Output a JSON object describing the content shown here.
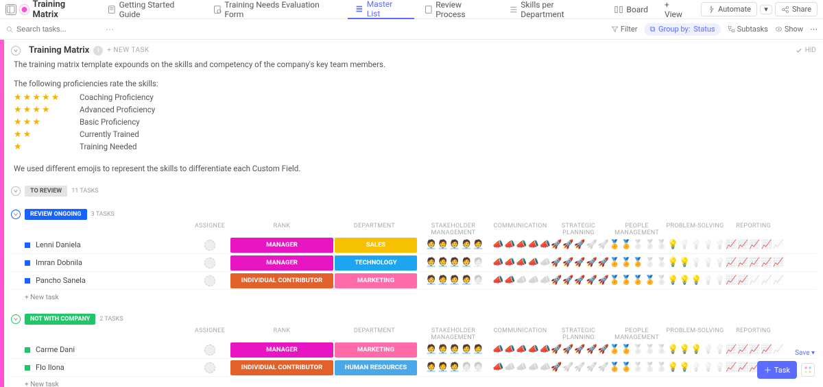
{
  "header": {
    "title": "Training Matrix",
    "tabs": [
      {
        "label": "Getting Started Guide"
      },
      {
        "label": "Training Needs Evaluation Form"
      },
      {
        "label": "Master List"
      },
      {
        "label": "Review Process"
      },
      {
        "label": "Skills per Department"
      },
      {
        "label": "Board"
      },
      {
        "label": "+ View"
      }
    ],
    "active_tab_index": 2,
    "automate": "Automate",
    "share": "Share"
  },
  "toolbar": {
    "search_placeholder": "Search tasks...",
    "filter": "Filter",
    "groupby_prefix": "Group by:",
    "groupby_value": "Status",
    "subtasks": "Subtasks",
    "show": "Show"
  },
  "section": {
    "title": "Training Matrix",
    "new_task": "+ NEW TASK",
    "hide": "HID",
    "description": "The training matrix template expounds on the skills and competency of the company's key team members.",
    "prof_heading": "The following proficiencies rate the skills:",
    "proficiencies": [
      {
        "stars": 5,
        "label": "Coaching Proficiency"
      },
      {
        "stars": 4,
        "label": "Advanced Proficiency"
      },
      {
        "stars": 3,
        "label": "Basic Proficiency"
      },
      {
        "stars": 2,
        "label": "Currently Trained"
      },
      {
        "stars": 1,
        "label": "Training Needed"
      }
    ],
    "emoji_note": "We used different emojis to represent the skills to differentiate each Custom Field."
  },
  "columns": {
    "assignee": "ASSIGNEE",
    "rank": "RANK",
    "department": "DEPARTMENT",
    "stakeholder": "STAKEHOLDER MANAGEMENT",
    "communication": "COMMUNICATION",
    "strategic": "STRATEGIC PLANNING",
    "people": "PEOPLE MANAGEMENT",
    "problem": "PROBLEM-SOLVING",
    "reporting": "REPORTING"
  },
  "groups": [
    {
      "status": "TO REVIEW",
      "chip_class": "to-review",
      "task_count": "11 TASKS",
      "rows": []
    },
    {
      "status": "REVIEW ONGOING",
      "chip_class": "review-ongoing",
      "task_count": "3 TASKS",
      "rows": [
        {
          "name": "Lenni Daniela",
          "rank": "MANAGER",
          "rank_class": "manager",
          "dept": "SALES",
          "dept_class": "sales",
          "skills": {
            "stakeholder": 5,
            "communication": 5,
            "strategic": 3,
            "people": 2,
            "problem": 1,
            "reporting": 4
          }
        },
        {
          "name": "Imran Dobnila",
          "rank": "MANAGER",
          "rank_class": "manager",
          "dept": "TECHNOLOGY",
          "dept_class": "tech",
          "skills": {
            "stakeholder": 4,
            "communication": 4,
            "strategic": 5,
            "people": 3,
            "problem": 2,
            "reporting": 5
          }
        },
        {
          "name": "Pancho Sanela",
          "rank": "INDIVIDUAL CONTRIBUTOR",
          "rank_class": "indiv",
          "dept": "MARKETING",
          "dept_class": "mkt",
          "skills": {
            "stakeholder": 4,
            "communication": 2,
            "strategic": 5,
            "people": 4,
            "problem": 3,
            "reporting": 2
          }
        }
      ],
      "add": "+ New task"
    },
    {
      "status": "NOT WITH COMPANY",
      "chip_class": "not-with",
      "task_count": "2 TASKS",
      "rows": [
        {
          "name": "Carme Dani",
          "rank": "MANAGER",
          "rank_class": "manager",
          "dept": "MARKETING",
          "dept_class": "mkt",
          "skills": {
            "stakeholder": 5,
            "communication": 5,
            "strategic": 5,
            "people": 2,
            "problem": 3,
            "reporting": 4
          }
        },
        {
          "name": "Flo Ilona",
          "rank": "INDIVIDUAL CONTRIBUTOR",
          "rank_class": "indiv",
          "dept": "HUMAN RESOURCES",
          "dept_class": "hr",
          "skills": {
            "stakeholder": 3,
            "communication": 1,
            "strategic": 1,
            "people": 2,
            "problem": 2,
            "reporting": 3
          }
        }
      ],
      "add": "+ New task"
    }
  ],
  "emojis": {
    "stakeholder": "🧑‍💼",
    "communication": "📣",
    "strategic": "🚀",
    "people": "🏅",
    "problem": "💡",
    "reporting": "📈"
  },
  "float": {
    "save": "Save ▾",
    "task": "Task"
  }
}
